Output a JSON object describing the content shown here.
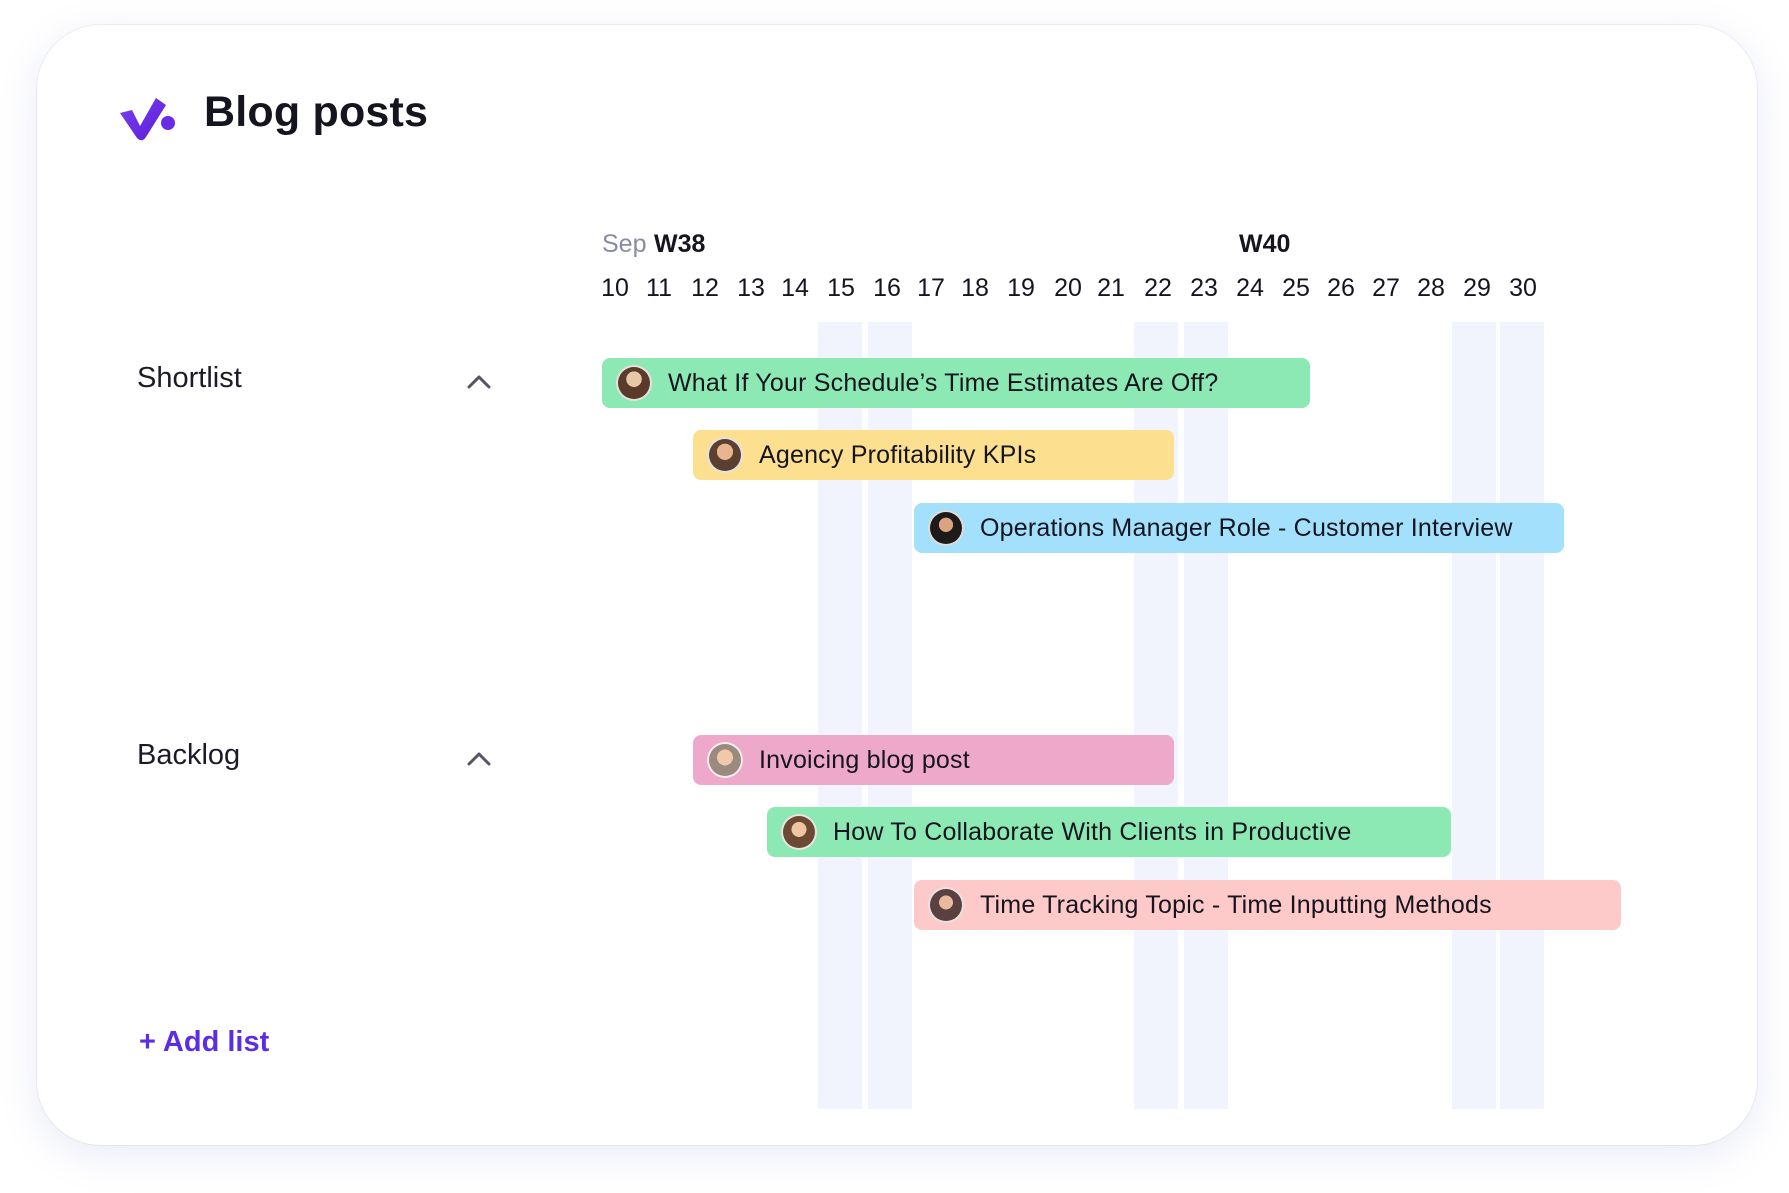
{
  "header": {
    "title": "Blog posts",
    "logo_icon": "productive-logo-icon"
  },
  "timeline": {
    "month": "Sep",
    "weeks": [
      "W38",
      "W40"
    ],
    "days": [
      "10",
      "11",
      "12",
      "13",
      "14",
      "15",
      "16",
      "17",
      "18",
      "19",
      "20",
      "21",
      "22",
      "23",
      "24",
      "25",
      "26",
      "27",
      "28",
      "29",
      "30"
    ]
  },
  "groups": [
    {
      "label": "Shortlist",
      "toggle_icon": "chevron-up-icon",
      "tasks": [
        {
          "label": "What If Your Schedule’s Time Estimates Are Off?",
          "color": "#8ce9b4"
        },
        {
          "label": "Agency Profitability KPIs",
          "color": "#fde08f"
        },
        {
          "label": "Operations Manager Role - Customer Interview",
          "color": "#a3e0fb"
        }
      ]
    },
    {
      "label": "Backlog",
      "toggle_icon": "chevron-up-icon",
      "tasks": [
        {
          "label": "Invoicing blog post",
          "color": "#eda8ca"
        },
        {
          "label": "How To Collaborate With Clients in Productive",
          "color": "#8ce9b4"
        },
        {
          "label": "Time Tracking Topic - Time Inputting Methods",
          "color": "#fdc9c9"
        }
      ]
    }
  ],
  "footer": {
    "add_list": "+ Add list"
  },
  "colors": {
    "accent": "#5b2ee6",
    "weekend": "#f1f4fd"
  }
}
